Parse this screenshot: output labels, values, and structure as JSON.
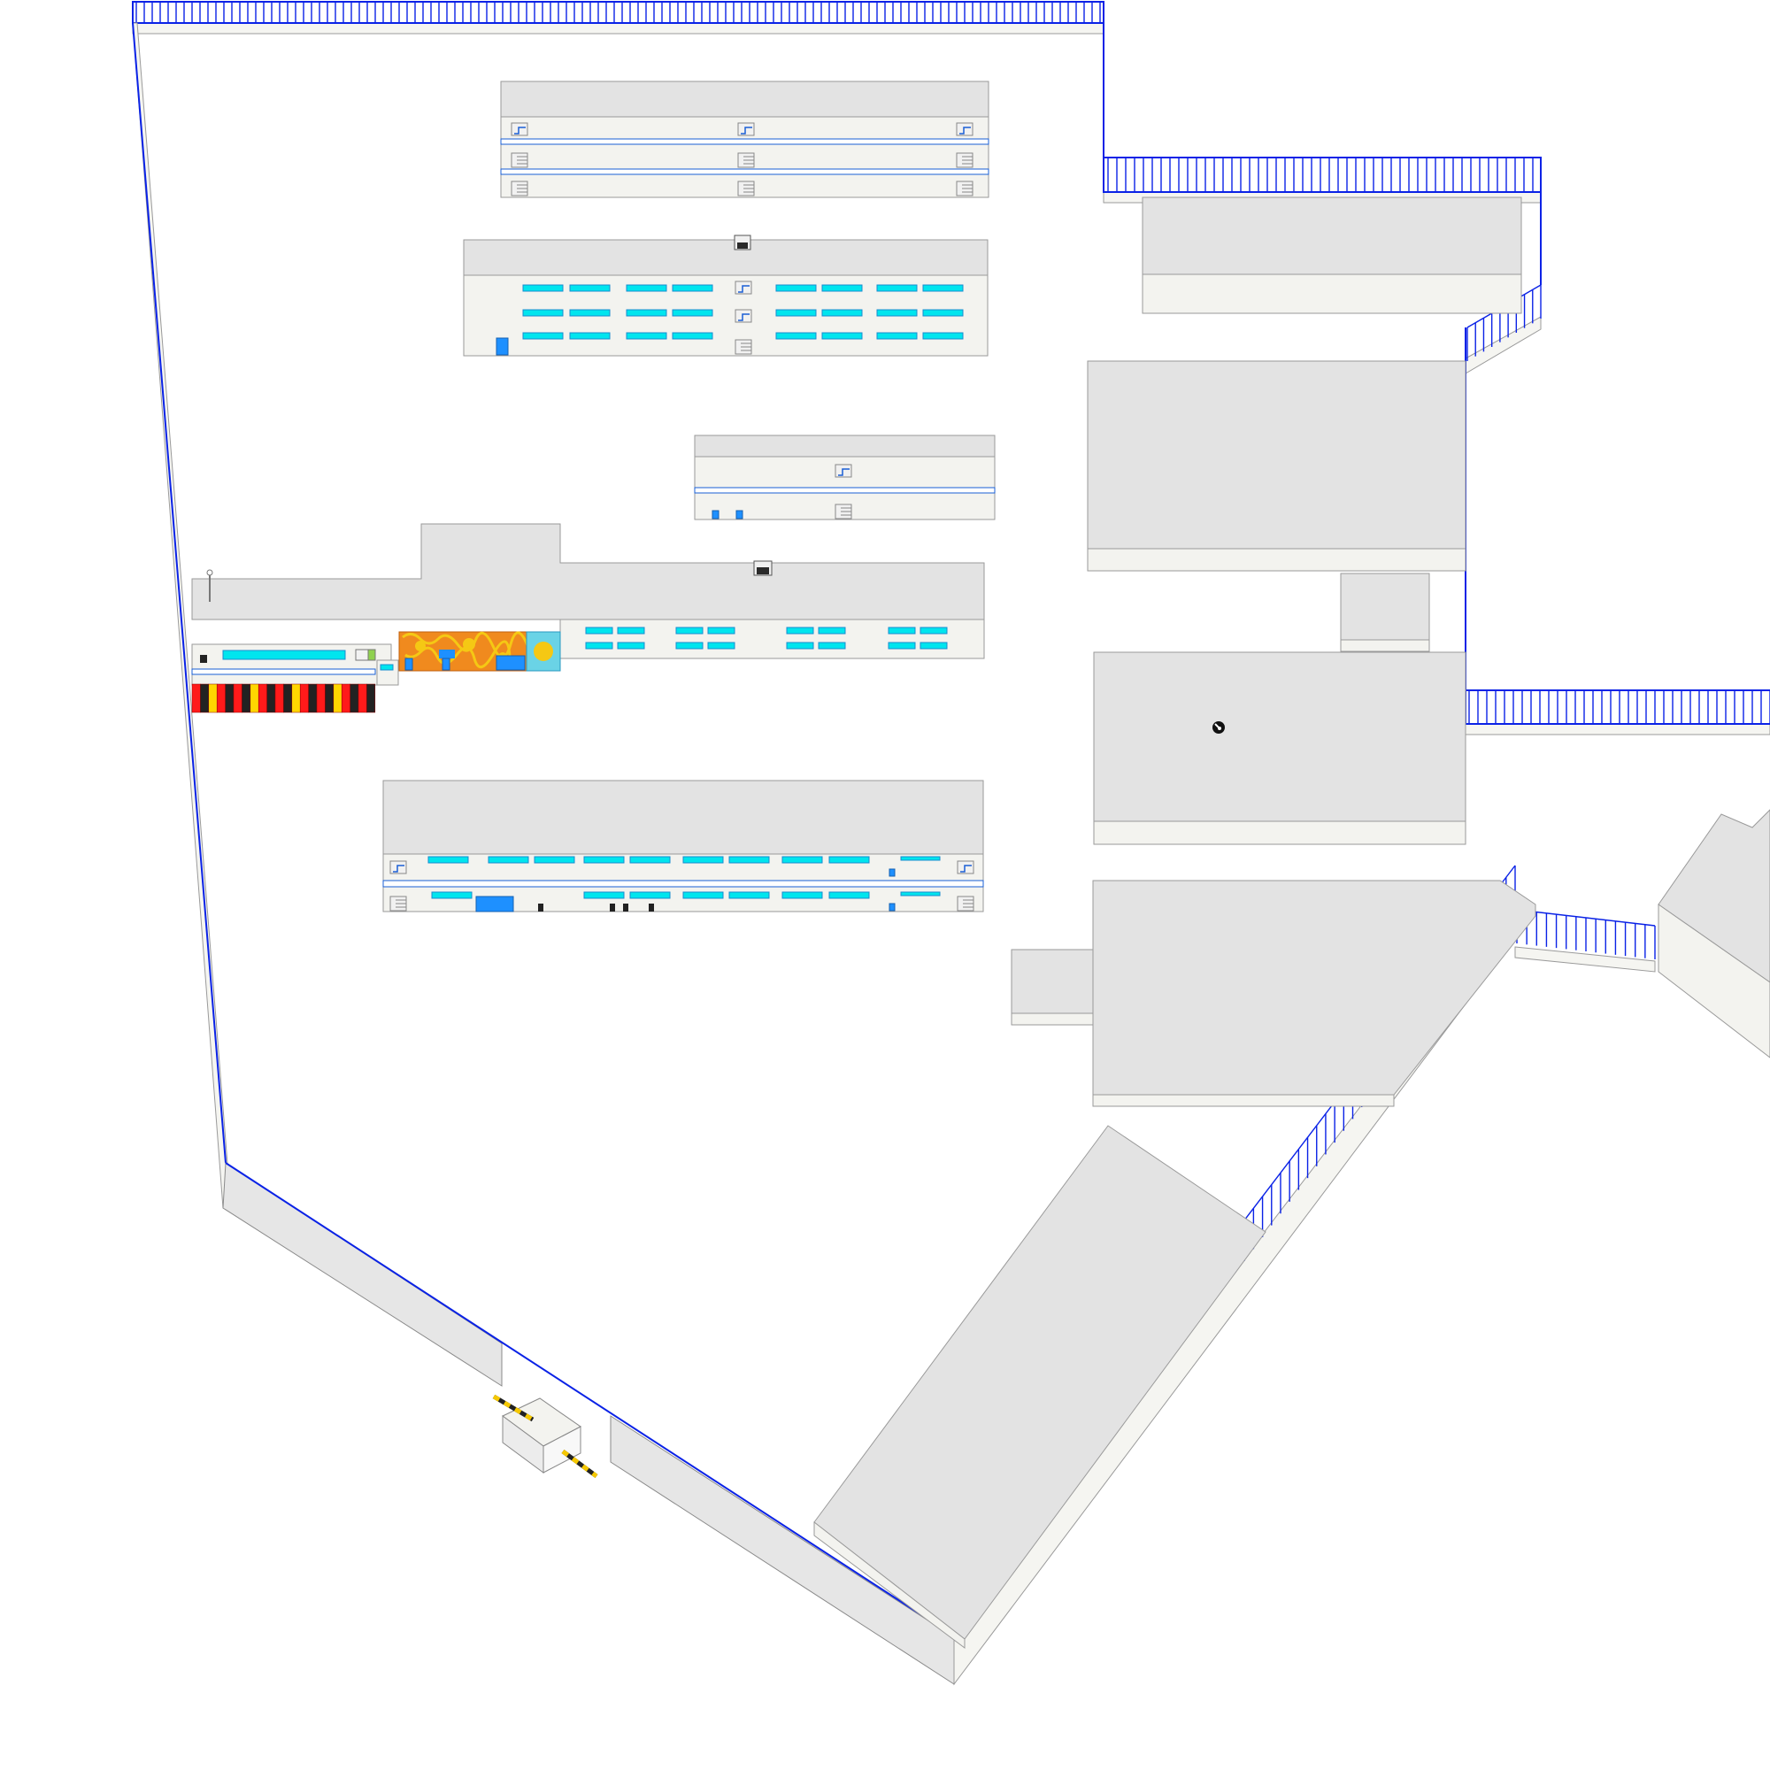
{
  "colors": {
    "fence": "#0a22e6",
    "roof": "#e3e3e3",
    "facade": "#f3f3ef",
    "window": "#00e5ee",
    "door": "#1e90ff",
    "mural_orange": "#f08a1e",
    "mural_yellow": "#f5c814",
    "awning_red": "#ff1a1a",
    "awning_black": "#222222",
    "awning_yellow": "#ffd700",
    "barrier_yellow": "#f5c800",
    "chimney_dark": "#2a2a2a"
  },
  "scene": {
    "kind": "isometric site plan",
    "buildings": [
      "building-a",
      "building-b",
      "building-c",
      "building-d",
      "building-e",
      "building-f",
      "building-g",
      "building-h",
      "building-i",
      "building-j",
      "building-k",
      "guard-booth"
    ],
    "icons": [
      "satellite-dish-icon",
      "antenna-icon",
      "security-camera-icon",
      "barrier-gate-icon",
      "mural-icon",
      "awning-icon",
      "stairwell-icon"
    ]
  }
}
